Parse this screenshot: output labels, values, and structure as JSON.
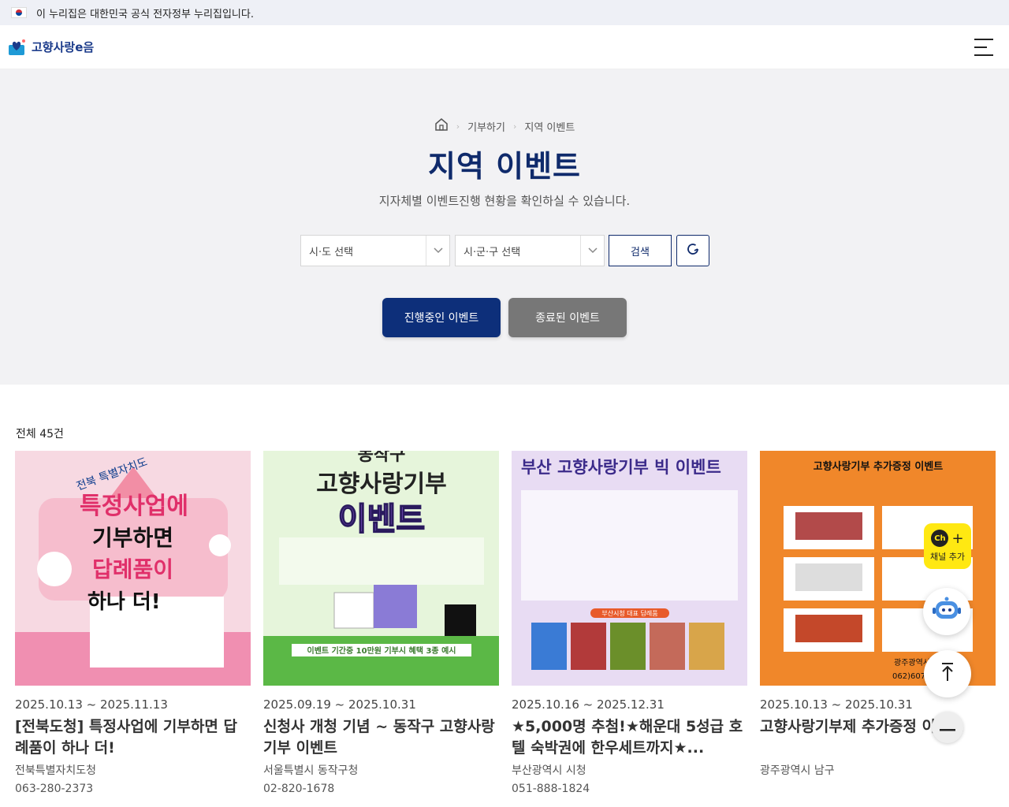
{
  "gov_banner": {
    "text": "이 누리집은 대한민국 공식 전자정부 누리집입니다."
  },
  "header": {
    "logo_text": "고향사랑e음",
    "menu_icon": "hamburger-icon"
  },
  "breadcrumb": {
    "items": [
      "기부하기",
      "지역 이벤트"
    ],
    "home_icon": "home-icon"
  },
  "page": {
    "title": "지역 이벤트",
    "description": "지자체별 이벤트진행 현황을 확인하실 수 있습니다."
  },
  "filters": {
    "province_placeholder": "시·도 선택",
    "district_placeholder": "시·군·구 선택",
    "search_label": "검색",
    "refresh_icon": "refresh-icon"
  },
  "tabs": [
    {
      "label": "진행중인 이벤트",
      "active": true
    },
    {
      "label": "종료된 이벤트",
      "active": false
    }
  ],
  "list": {
    "count_label": "전체 45건",
    "cards": [
      {
        "period": "2025.10.13 ~ 2025.11.13",
        "title": "[전북도청] 특정사업에 기부하면 답례품이 하나 더!",
        "org": "전북특별자치도청",
        "phone": "063-280-2373",
        "thumb_lines": [
          "전북 특별자치도",
          "특정사업에",
          "기부하면",
          "답례품이",
          "하나 더!"
        ]
      },
      {
        "period": "2025.09.19 ~ 2025.10.31",
        "title": "신청사 개청 기념 ~ 동작구 고향사랑기부 이벤트",
        "org": "서울특별시 동작구청",
        "phone": "02-820-1678",
        "thumb_lines": [
          "동작구",
          "고향사랑기부",
          "이벤트",
          "이벤트 기간중 10만원 기부시 혜택 3종 예시"
        ]
      },
      {
        "period": "2025.10.16 ~ 2025.12.31",
        "title": "★5,000명 추첨!★해운대 5성급 호텔 숙박권에 한우세트까지★...",
        "org": "부산광역시 시청",
        "phone": "051-888-1824",
        "thumb_lines": [
          "부산 고향사랑기부 빅 이벤트",
          "부산시청 대표 답례품"
        ]
      },
      {
        "period": "2025.10.13 ~ 2025.10.31",
        "title": "고향사랑기부제 추가증정 이벤트",
        "org": "광주광역시 남구",
        "phone": "",
        "thumb_lines": [
          "고향사랑기부 추가증정 이벤트",
          "광주광역시 남구",
          "062)607-2882"
        ]
      }
    ]
  },
  "floating": {
    "channel_label": "채널 추가",
    "channel_badge": "Ch",
    "chatbot_icon": "chatbot-icon",
    "top_icon": "arrow-up-icon",
    "minimize_icon": "minus-icon"
  },
  "colors": {
    "primary": "#0d2f7a",
    "title": "#0f2a6b",
    "inactive_tab": "#777777",
    "hero_bg": "#f2f2f4"
  }
}
